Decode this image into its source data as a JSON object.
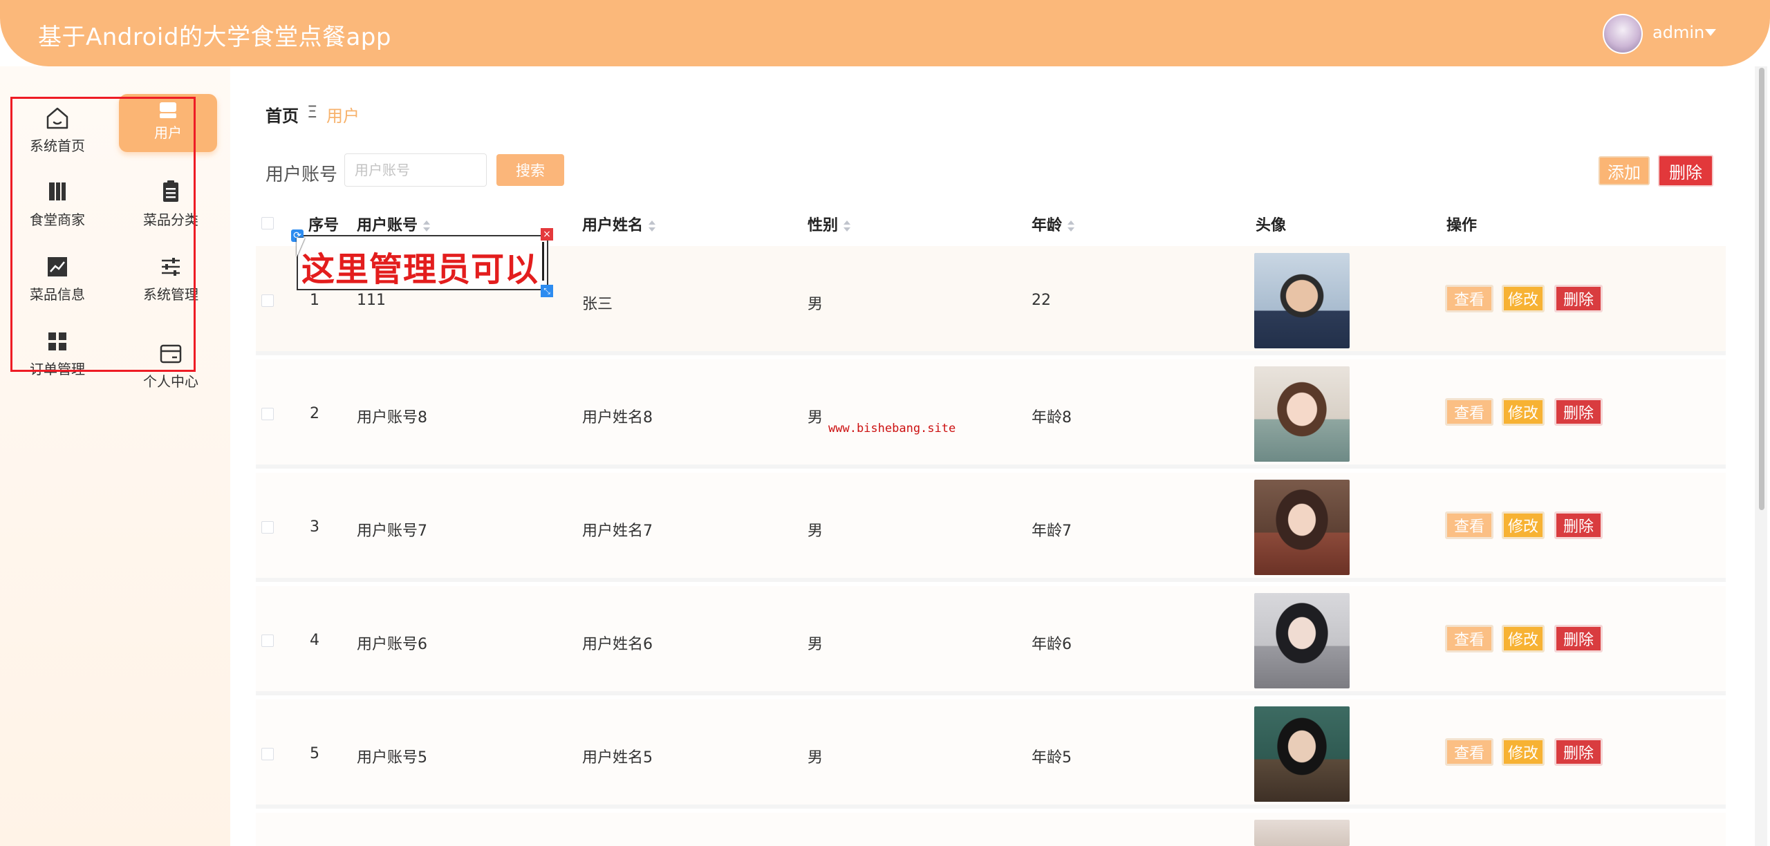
{
  "header": {
    "title": "基于Android的大学食堂点餐app",
    "user": "admin"
  },
  "sidebar": {
    "items": [
      {
        "label": "系统首页",
        "icon": "home-icon"
      },
      {
        "label": "用户",
        "icon": "user-store-icon",
        "active": true
      },
      {
        "label": "食堂商家",
        "icon": "book-icon"
      },
      {
        "label": "菜品分类",
        "icon": "clipboard-icon"
      },
      {
        "label": "菜品信息",
        "icon": "chart-icon"
      },
      {
        "label": "系统管理",
        "icon": "sliders-icon"
      },
      {
        "label": "订单管理",
        "icon": "grid-icon"
      },
      {
        "label": "个人中心",
        "icon": "wallet-icon"
      }
    ]
  },
  "breadcrumb": {
    "home": "首页",
    "separator": "Ξ",
    "current": "用户"
  },
  "search": {
    "label": "用户账号",
    "placeholder": "用户账号",
    "button": "搜索"
  },
  "actions": {
    "add": "添加",
    "delete": "删除"
  },
  "table": {
    "columns": [
      "序号",
      "用户账号",
      "用户姓名",
      "性别",
      "年龄",
      "头像",
      "操作"
    ],
    "rows": [
      {
        "index": "1",
        "account": "111",
        "name": "张三",
        "gender": "男",
        "age": "22"
      },
      {
        "index": "2",
        "account": "用户账号8",
        "name": "用户姓名8",
        "gender": "男",
        "age": "年龄8"
      },
      {
        "index": "3",
        "account": "用户账号7",
        "name": "用户姓名7",
        "gender": "男",
        "age": "年龄7"
      },
      {
        "index": "4",
        "account": "用户账号6",
        "name": "用户姓名6",
        "gender": "男",
        "age": "年龄6"
      },
      {
        "index": "5",
        "account": "用户账号5",
        "name": "用户姓名5",
        "gender": "男",
        "age": "年龄5"
      }
    ],
    "row_actions": {
      "view": "查看",
      "edit": "修改",
      "delete": "删除"
    }
  },
  "annotation": {
    "text": "这里管理员可以"
  },
  "watermark": "www.bishebang.site",
  "colors": {
    "accent": "#fbb574",
    "danger": "#d93c3f",
    "warning": "#f7b233",
    "annotation_text": "#e31d1d"
  }
}
